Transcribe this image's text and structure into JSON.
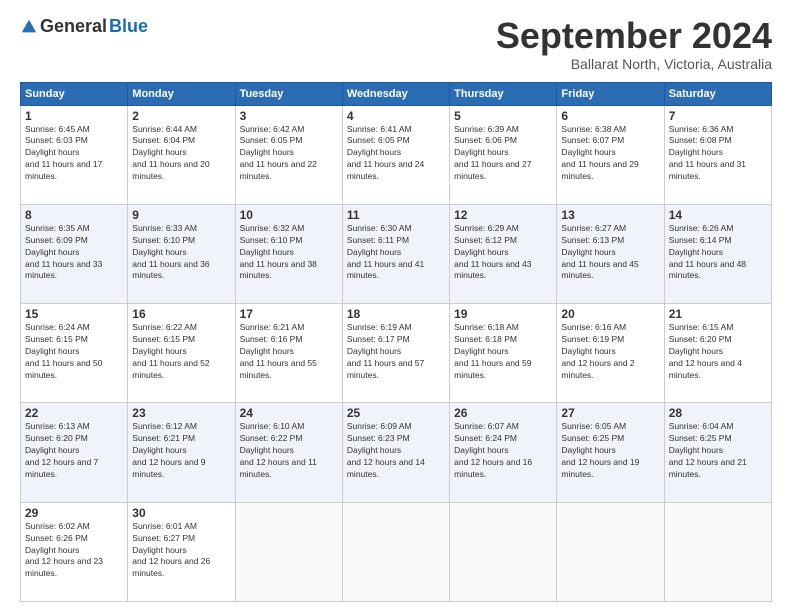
{
  "logo": {
    "general": "General",
    "blue": "Blue"
  },
  "title": "September 2024",
  "subtitle": "Ballarat North, Victoria, Australia",
  "headers": [
    "Sunday",
    "Monday",
    "Tuesday",
    "Wednesday",
    "Thursday",
    "Friday",
    "Saturday"
  ],
  "weeks": [
    [
      {
        "day": "1",
        "rise": "6:45 AM",
        "set": "6:03 PM",
        "daylight": "11 hours and 17 minutes."
      },
      {
        "day": "2",
        "rise": "6:44 AM",
        "set": "6:04 PM",
        "daylight": "11 hours and 20 minutes."
      },
      {
        "day": "3",
        "rise": "6:42 AM",
        "set": "6:05 PM",
        "daylight": "11 hours and 22 minutes."
      },
      {
        "day": "4",
        "rise": "6:41 AM",
        "set": "6:05 PM",
        "daylight": "11 hours and 24 minutes."
      },
      {
        "day": "5",
        "rise": "6:39 AM",
        "set": "6:06 PM",
        "daylight": "11 hours and 27 minutes."
      },
      {
        "day": "6",
        "rise": "6:38 AM",
        "set": "6:07 PM",
        "daylight": "11 hours and 29 minutes."
      },
      {
        "day": "7",
        "rise": "6:36 AM",
        "set": "6:08 PM",
        "daylight": "11 hours and 31 minutes."
      }
    ],
    [
      {
        "day": "8",
        "rise": "6:35 AM",
        "set": "6:09 PM",
        "daylight": "11 hours and 33 minutes."
      },
      {
        "day": "9",
        "rise": "6:33 AM",
        "set": "6:10 PM",
        "daylight": "11 hours and 36 minutes."
      },
      {
        "day": "10",
        "rise": "6:32 AM",
        "set": "6:10 PM",
        "daylight": "11 hours and 38 minutes."
      },
      {
        "day": "11",
        "rise": "6:30 AM",
        "set": "6:11 PM",
        "daylight": "11 hours and 41 minutes."
      },
      {
        "day": "12",
        "rise": "6:29 AM",
        "set": "6:12 PM",
        "daylight": "11 hours and 43 minutes."
      },
      {
        "day": "13",
        "rise": "6:27 AM",
        "set": "6:13 PM",
        "daylight": "11 hours and 45 minutes."
      },
      {
        "day": "14",
        "rise": "6:26 AM",
        "set": "6:14 PM",
        "daylight": "11 hours and 48 minutes."
      }
    ],
    [
      {
        "day": "15",
        "rise": "6:24 AM",
        "set": "6:15 PM",
        "daylight": "11 hours and 50 minutes."
      },
      {
        "day": "16",
        "rise": "6:22 AM",
        "set": "6:15 PM",
        "daylight": "11 hours and 52 minutes."
      },
      {
        "day": "17",
        "rise": "6:21 AM",
        "set": "6:16 PM",
        "daylight": "11 hours and 55 minutes."
      },
      {
        "day": "18",
        "rise": "6:19 AM",
        "set": "6:17 PM",
        "daylight": "11 hours and 57 minutes."
      },
      {
        "day": "19",
        "rise": "6:18 AM",
        "set": "6:18 PM",
        "daylight": "11 hours and 59 minutes."
      },
      {
        "day": "20",
        "rise": "6:16 AM",
        "set": "6:19 PM",
        "daylight": "12 hours and 2 minutes."
      },
      {
        "day": "21",
        "rise": "6:15 AM",
        "set": "6:20 PM",
        "daylight": "12 hours and 4 minutes."
      }
    ],
    [
      {
        "day": "22",
        "rise": "6:13 AM",
        "set": "6:20 PM",
        "daylight": "12 hours and 7 minutes."
      },
      {
        "day": "23",
        "rise": "6:12 AM",
        "set": "6:21 PM",
        "daylight": "12 hours and 9 minutes."
      },
      {
        "day": "24",
        "rise": "6:10 AM",
        "set": "6:22 PM",
        "daylight": "12 hours and 11 minutes."
      },
      {
        "day": "25",
        "rise": "6:09 AM",
        "set": "6:23 PM",
        "daylight": "12 hours and 14 minutes."
      },
      {
        "day": "26",
        "rise": "6:07 AM",
        "set": "6:24 PM",
        "daylight": "12 hours and 16 minutes."
      },
      {
        "day": "27",
        "rise": "6:05 AM",
        "set": "6:25 PM",
        "daylight": "12 hours and 19 minutes."
      },
      {
        "day": "28",
        "rise": "6:04 AM",
        "set": "6:25 PM",
        "daylight": "12 hours and 21 minutes."
      }
    ],
    [
      {
        "day": "29",
        "rise": "6:02 AM",
        "set": "6:26 PM",
        "daylight": "12 hours and 23 minutes."
      },
      {
        "day": "30",
        "rise": "6:01 AM",
        "set": "6:27 PM",
        "daylight": "12 hours and 26 minutes."
      },
      null,
      null,
      null,
      null,
      null
    ]
  ]
}
